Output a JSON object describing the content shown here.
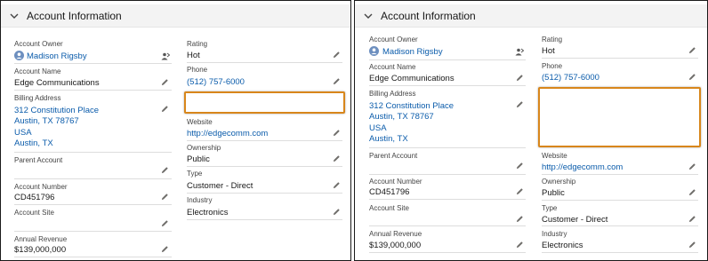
{
  "section_title": "Account Information",
  "left_column": {
    "account_owner_label": "Account Owner",
    "account_owner_value": "Madison Rigsby",
    "account_name_label": "Account Name",
    "account_name_value": "Edge Communications",
    "billing_address_label": "Billing Address",
    "billing_address_lines": [
      "312 Constitution Place",
      "Austin, TX 78767",
      "USA",
      "Austin, TX"
    ],
    "parent_account_label": "Parent Account",
    "parent_account_value": "",
    "account_number_label": "Account Number",
    "account_number_value": "CD451796",
    "account_site_label": "Account Site",
    "account_site_value": "",
    "annual_revenue_label": "Annual Revenue",
    "annual_revenue_value": "$139,000,000"
  },
  "right_column": {
    "rating_label": "Rating",
    "rating_value": "Hot",
    "phone_label": "Phone",
    "phone_value": "(512) 757-6000",
    "website_label": "Website",
    "website_value": "http://edgecomm.com",
    "ownership_label": "Ownership",
    "ownership_value": "Public",
    "type_label": "Type",
    "type_value": "Customer - Direct",
    "industry_label": "Industry",
    "industry_value": "Electronics"
  },
  "icons": {
    "collapse": "chevron-down-icon",
    "edit": "pencil-icon",
    "avatar": "user-avatar-icon",
    "change_owner": "change-owner-icon"
  },
  "colors": {
    "link": "#0b5cab",
    "highlight": "#d8861b",
    "header_bg": "#f3f3f3"
  }
}
